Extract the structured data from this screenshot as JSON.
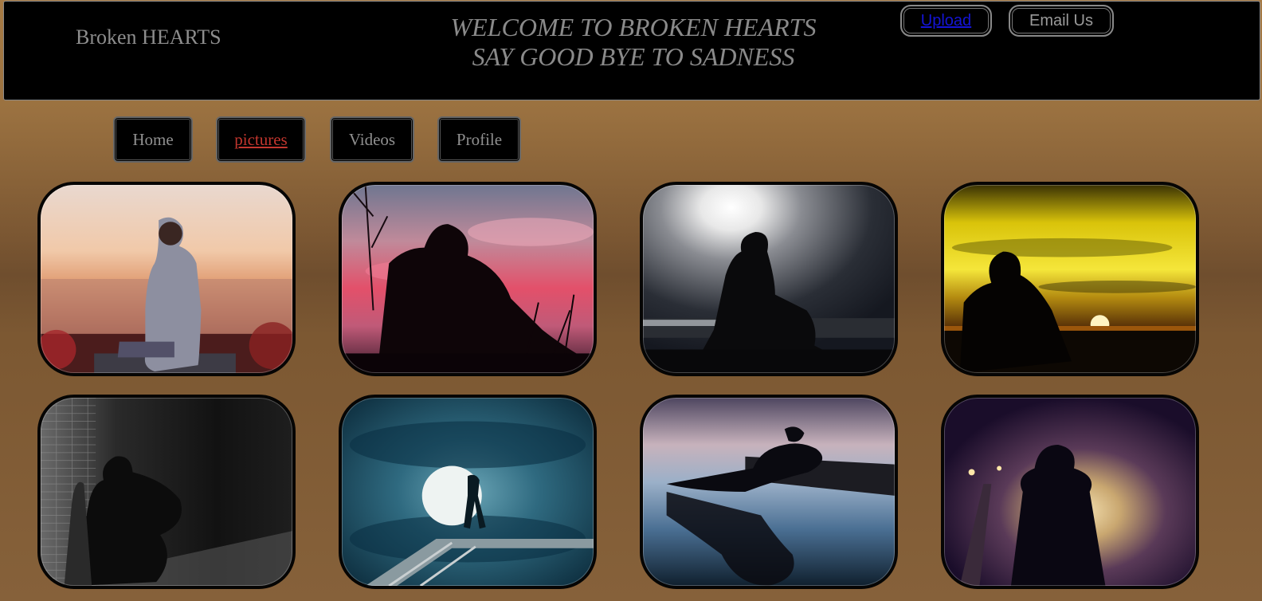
{
  "header": {
    "brand": "Broken HEARTS",
    "welcome_line1": "WELCOME TO BROKEN HEARTS",
    "welcome_line2": "SAY GOOD BYE TO SADNESS",
    "upload_label": "Upload",
    "email_label": "Email Us"
  },
  "nav": {
    "items": [
      {
        "label": "Home"
      },
      {
        "label": "pictures"
      },
      {
        "label": "Videos"
      },
      {
        "label": "Profile"
      }
    ],
    "active": "pictures"
  },
  "gallery": {
    "pictures": [
      {
        "subject": "man in hoodie sitting on bench at sunset over city"
      },
      {
        "subject": "silhouette sitting under pink clouds"
      },
      {
        "subject": "silhouette sitting under moon by the sea"
      },
      {
        "subject": "silhouette at sunset with yellow sky"
      },
      {
        "subject": "silhouette leaning on brick wall in black and white"
      },
      {
        "subject": "silhouette walking on bridge past full moon"
      },
      {
        "subject": "silhouette crouched on dock with reflection"
      },
      {
        "subject": "silhouette walking toward car headlights"
      }
    ]
  },
  "colors": {
    "header_bg": "#000000",
    "text_gray": "#8d8d8d",
    "active_link": "#c2362e",
    "upload_link": "#1414d6",
    "page_bg": "#86613a"
  }
}
